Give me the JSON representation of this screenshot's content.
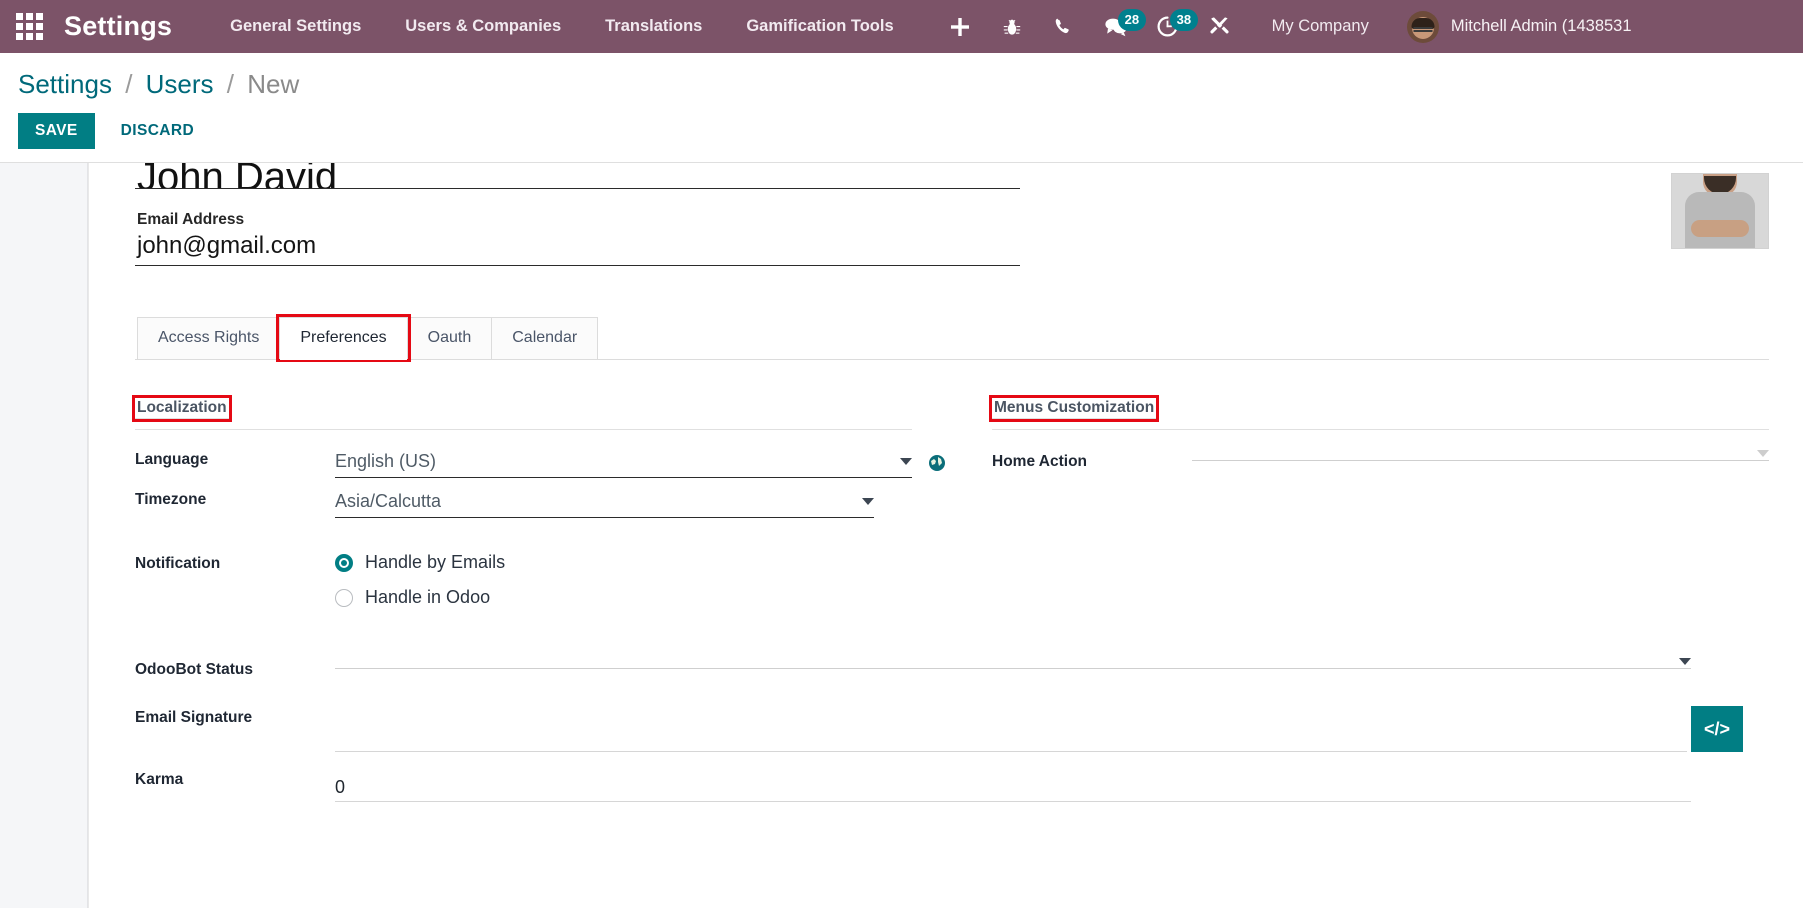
{
  "navbar": {
    "apps_icon": "apps-grid-icon",
    "brand": "Settings",
    "menu_items": [
      {
        "label": "General Settings"
      },
      {
        "label": "Users & Companies"
      },
      {
        "label": "Translations"
      },
      {
        "label": "Gamification Tools"
      }
    ],
    "icons": [
      {
        "name": "plus-icon",
        "badge": ""
      },
      {
        "name": "bug-icon",
        "badge": ""
      },
      {
        "name": "phone-icon",
        "badge": ""
      },
      {
        "name": "messages-icon",
        "badge": "28"
      },
      {
        "name": "activities-clock-icon",
        "badge": "38"
      },
      {
        "name": "tools-icon",
        "badge": ""
      }
    ],
    "company": "My Company",
    "user": "Mitchell Admin (1438531",
    "background_color": "#7c5368",
    "badge_color": "#00808e"
  },
  "control_panel": {
    "breadcrumb": {
      "root": "Settings",
      "parent": "Users",
      "current": "New",
      "separator": "/"
    },
    "save_label": "SAVE",
    "discard_label": "DISCARD",
    "accent_color": "#017e84"
  },
  "record": {
    "name": "John David",
    "email_label": "Email Address",
    "email": "john@gmail.com",
    "avatar_name": "user-photo-placeholder"
  },
  "notebook": {
    "tabs": [
      {
        "label": "Access Rights",
        "active": false,
        "highlighted": false
      },
      {
        "label": "Preferences",
        "active": true,
        "highlighted": true
      },
      {
        "label": "Oauth",
        "active": false,
        "highlighted": false
      },
      {
        "label": "Calendar",
        "active": false,
        "highlighted": false
      }
    ]
  },
  "preferences": {
    "left_group": {
      "title": "Localization",
      "highlighted": true,
      "language": {
        "label": "Language",
        "value": "English (US)",
        "translate_icon": "globe-icon"
      },
      "timezone": {
        "label": "Timezone",
        "value": "Asia/Calcutta"
      },
      "notification": {
        "label": "Notification",
        "options": [
          {
            "label": "Handle by Emails",
            "selected": true
          },
          {
            "label": "Handle in Odoo",
            "selected": false
          }
        ]
      },
      "odoobot_status": {
        "label": "OdooBot Status",
        "value": ""
      },
      "email_signature": {
        "label": "Email Signature",
        "value": "",
        "code_button": "</>"
      },
      "karma": {
        "label": "Karma",
        "value": "0"
      }
    },
    "right_group": {
      "title": "Menus Customization",
      "highlighted": true,
      "home_action": {
        "label": "Home Action",
        "value": ""
      }
    }
  },
  "highlight_color": "#e50914"
}
